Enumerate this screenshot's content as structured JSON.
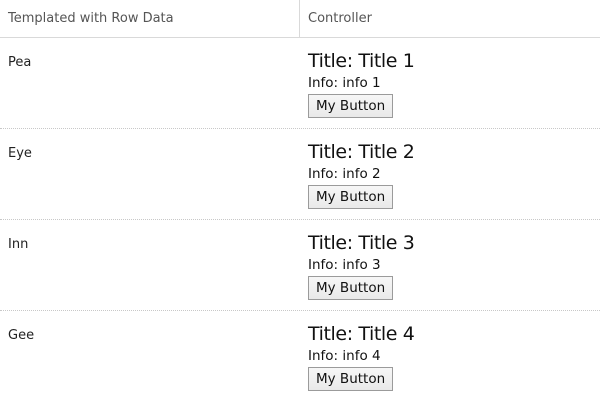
{
  "grid": {
    "columns": [
      "Templated with Row Data",
      "Controller"
    ],
    "title_prefix": "Title: ",
    "info_prefix": "Info: ",
    "rows": [
      {
        "name": "Pea",
        "title": "Title 1",
        "info": "info 1",
        "button_label": "My Button"
      },
      {
        "name": "Eye",
        "title": "Title 2",
        "info": "info 2",
        "button_label": "My Button"
      },
      {
        "name": "Inn",
        "title": "Title 3",
        "info": "info 3",
        "button_label": "My Button"
      },
      {
        "name": "Gee",
        "title": "Title 4",
        "info": "info 4",
        "button_label": "My Button"
      }
    ]
  }
}
